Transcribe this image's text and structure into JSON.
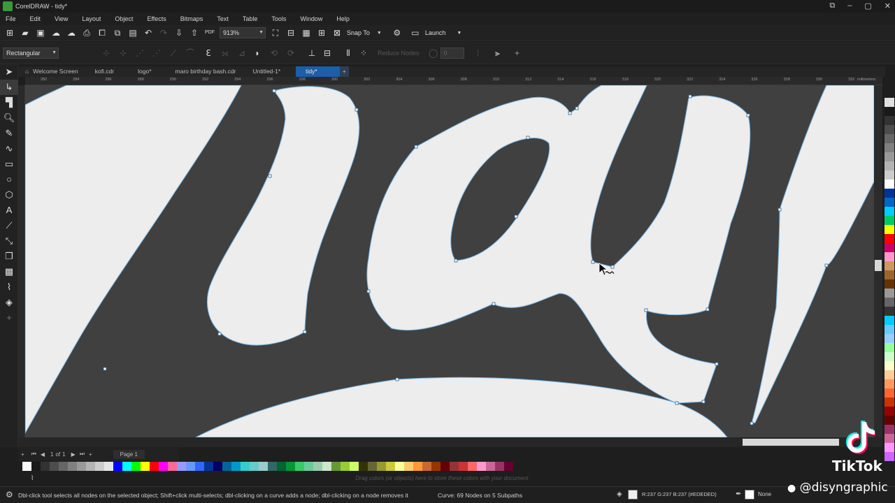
{
  "app": {
    "title": "CorelDRAW - tidy*"
  },
  "menu": [
    "File",
    "Edit",
    "View",
    "Layout",
    "Object",
    "Effects",
    "Bitmaps",
    "Text",
    "Table",
    "Tools",
    "Window",
    "Help"
  ],
  "toolbar": {
    "zoom": "913%",
    "snap_label": "Snap To",
    "launch_label": "Launch"
  },
  "property_bar": {
    "selection_mode": "Rectangular",
    "reduce_nodes": "Reduce Nodes",
    "smoothness": "0"
  },
  "doc_tabs": [
    {
      "label": "Welcome Screen",
      "active": false
    },
    {
      "label": "kofi.cdr",
      "active": false
    },
    {
      "label": "logo*",
      "active": false
    },
    {
      "label": "maro birthday bash.cdr",
      "active": false
    },
    {
      "label": "Untitled-1*",
      "active": false
    },
    {
      "label": "tidy*",
      "active": true
    }
  ],
  "ruler": {
    "unit": "millimeters",
    "ticks": [
      "282",
      "284",
      "286",
      "288",
      "290",
      "292",
      "294",
      "296",
      "298",
      "300",
      "302",
      "304",
      "306",
      "308",
      "310",
      "312",
      "314",
      "316",
      "318",
      "320",
      "322",
      "324",
      "326",
      "328",
      "330",
      "332"
    ]
  },
  "page_nav": {
    "current": "1",
    "of": "of",
    "total": "1",
    "page_tab": "Page 1"
  },
  "palette_hint": "Drag colors (or objects) here to store these colors with your document",
  "status": {
    "hint": "Dbl-click tool selects all nodes on the selected object; Shift+click multi-selects; dbl-clicking on a curve adds a node; dbl-clicking on a node removes it",
    "curve_info": "Curve: 69 Nodes on 5 Subpaths",
    "fill_info": "R:237 G:237 B:237 (#EDEDED)",
    "outline_info": "None"
  },
  "watermark": {
    "brand": "TikTok",
    "handle": "@disyngraphic"
  },
  "colors": {
    "shape_fill": "#ededed",
    "canvas_bg": "#404040",
    "node_outline": "#7ab3e0",
    "accent": "#1c5ea8"
  },
  "palette_colors": [
    "#ffffff",
    "#1a1a1a",
    "#333333",
    "#4d4d4d",
    "#666666",
    "#808080",
    "#999999",
    "#b3b3b3",
    "#cccccc",
    "#e6e6e6",
    "#0000ff",
    "#00ffff",
    "#00ff00",
    "#ffff00",
    "#ff0000",
    "#ff00ff",
    "#ff6699",
    "#9999ff",
    "#6699ff",
    "#3366ff",
    "#003399",
    "#000066",
    "#006699",
    "#0099cc",
    "#33cccc",
    "#66cccc",
    "#99cccc",
    "#336666",
    "#006633",
    "#009933",
    "#33cc66",
    "#66cc99",
    "#99ccaa",
    "#cce6cc",
    "#669933",
    "#99cc33",
    "#ccff66",
    "#333300",
    "#666633",
    "#999933",
    "#cccc33",
    "#ffff99",
    "#ffcc66",
    "#ff9933",
    "#cc6633",
    "#993300",
    "#660000",
    "#993333",
    "#cc3333",
    "#ff6666",
    "#ff99cc",
    "#cc6699",
    "#993366",
    "#660033"
  ]
}
